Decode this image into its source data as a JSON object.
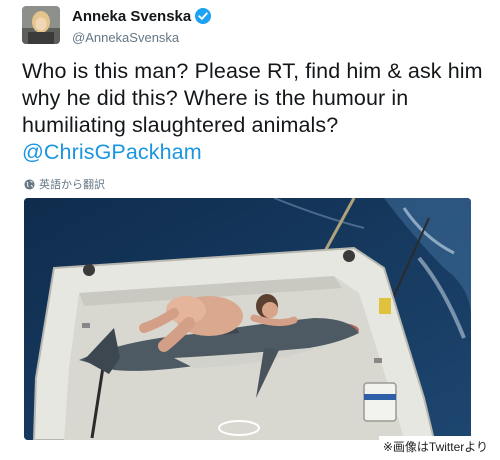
{
  "tweet": {
    "display_name": "Anneka Svenska",
    "handle": "@AnnekaSvenska",
    "text_before": "Who is this man? Please RT, find him & ask him why he did this? Where is the humour in humiliating slaughtered animals? ",
    "mention": "@ChrisGPackham",
    "translate_label": "英語から翻訳",
    "verified_icon": "verified-badge-icon",
    "globe_icon": "globe-icon"
  },
  "credit": {
    "text": "※画像はTwitterより"
  },
  "colors": {
    "link": "#1b95e0",
    "verified": "#1da1f2",
    "secondary_text": "#657786",
    "sea": "#123254"
  }
}
